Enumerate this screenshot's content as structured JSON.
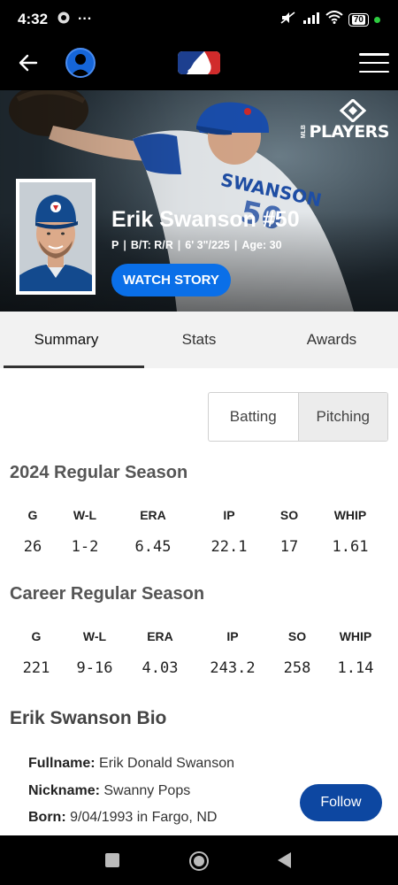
{
  "status_bar": {
    "time": "4:32",
    "more": "···",
    "battery": "70"
  },
  "header": {
    "back_icon": "arrow-left-icon",
    "profile_icon": "user-icon",
    "logo": "mlb-logo",
    "menu_icon": "hamburger-icon"
  },
  "hero": {
    "players_logo_small": "MLB",
    "players_logo_word": "PLAYERS",
    "player_name": "Erik Swanson #50",
    "position": "P",
    "bats_throws": "B/T: R/R",
    "height_weight": "6' 3\"/225",
    "age": "Age: 30",
    "watch_label": "WATCH STORY"
  },
  "tabs": [
    {
      "label": "Summary",
      "active": true
    },
    {
      "label": "Stats",
      "active": false
    },
    {
      "label": "Awards",
      "active": false
    }
  ],
  "toggle": {
    "batting": "Batting",
    "pitching": "Pitching",
    "selected": "Pitching"
  },
  "season": {
    "title": "2024 Regular Season",
    "headers": [
      "G",
      "W-L",
      "ERA",
      "IP",
      "SO",
      "WHIP"
    ],
    "values": [
      "26",
      "1-2",
      "6.45",
      "22.1",
      "17",
      "1.61"
    ]
  },
  "career": {
    "title": "Career Regular Season",
    "headers": [
      "G",
      "W-L",
      "ERA",
      "IP",
      "SO",
      "WHIP"
    ],
    "values": [
      "221",
      "9-16",
      "4.03",
      "243.2",
      "258",
      "1.14"
    ]
  },
  "bio": {
    "title": "Erik Swanson Bio",
    "fullname_label": "Fullname:",
    "fullname": "Erik Donald Swanson",
    "nickname_label": "Nickname:",
    "nickname": "Swanny Pops",
    "born_label": "Born:",
    "born": "9/04/1993 in Fargo, ND",
    "follow_label": "Follow"
  },
  "colors": {
    "accent_blue": "#0a6fe8",
    "follow_blue": "#0d47a1",
    "jays_blue": "#134a8e"
  }
}
